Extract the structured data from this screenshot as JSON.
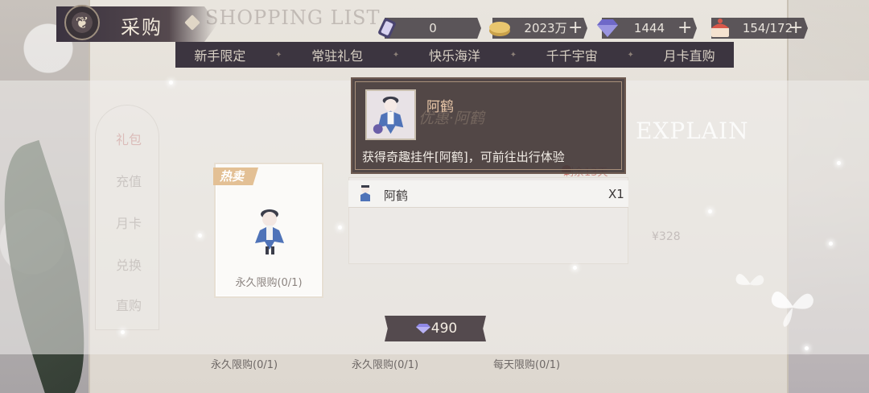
{
  "header": {
    "title": "采购",
    "title_icon": "butterfly-emblem",
    "background_title": "SHOPPING LIST"
  },
  "resources": [
    {
      "icon": "coin-stack-icon",
      "value": "0"
    },
    {
      "icon": "gold-coin-icon",
      "value": "2023万"
    },
    {
      "icon": "diamond-icon",
      "value": "1444"
    },
    {
      "icon": "cake-stamina-icon",
      "value": "154/172"
    }
  ],
  "tabs": [
    "新手限定",
    "常驻礼包",
    "快乐海洋",
    "千千宇宙",
    "月卡直购"
  ],
  "side_menu": [
    "礼包",
    "充值",
    "月卡",
    "兑换",
    "直购"
  ],
  "card": {
    "tag": "热卖",
    "limit": "永久限购(0/1)"
  },
  "tooltip": {
    "name": "阿鹤",
    "description": "获得奇趣挂件[阿鹤]，可前往出行体验",
    "background_title": "优惠·阿鹤"
  },
  "detail": {
    "remain": "剩余13天",
    "item_name": "阿鹤",
    "item_qty": "X1"
  },
  "price": {
    "value": "490",
    "icon": "diamond-icon"
  },
  "bottom_limits": [
    "永久限购(0/1)",
    "永久限购(0/1)",
    "每天限购(0/1)"
  ],
  "decor": {
    "explain": "EXPLAIN",
    "ghost_price": "¥328"
  },
  "colors": {
    "panel_dark": "#3c3540",
    "tooltip_bg": "#463a3a",
    "tag": "#e3c095",
    "tooltip_name": "#e9c7a8"
  }
}
